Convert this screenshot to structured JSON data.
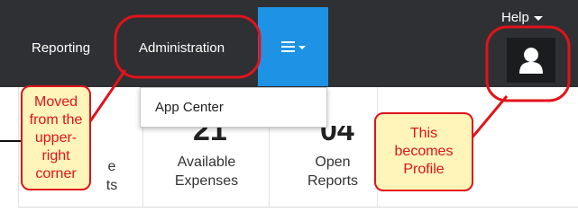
{
  "header": {
    "help_label": "Help",
    "nav": {
      "reporting": "Reporting",
      "administration": "Administration"
    },
    "menu_icon": "hamburger-icon",
    "profile_icon": "user-icon"
  },
  "dropdown": {
    "items": [
      {
        "label": "App Center"
      }
    ]
  },
  "cards": [
    {
      "number_fragment": "",
      "label_lines": [
        "e",
        "ts"
      ]
    },
    {
      "number_fragment": "21",
      "label_lines": [
        "Available",
        "Expenses"
      ]
    },
    {
      "number_fragment": "04",
      "label_lines": [
        "Open",
        "Reports"
      ]
    }
  ],
  "annotations": {
    "left_callout": [
      "Moved",
      "from the",
      "upper-",
      "right",
      "corner"
    ],
    "right_callout": [
      "This",
      "becomes",
      "Profile"
    ]
  },
  "colors": {
    "topbar": "#2e3033",
    "menu_active": "#1e93e6",
    "annotation_red": "#e0131b",
    "annotation_fill": "#fff5b8"
  }
}
